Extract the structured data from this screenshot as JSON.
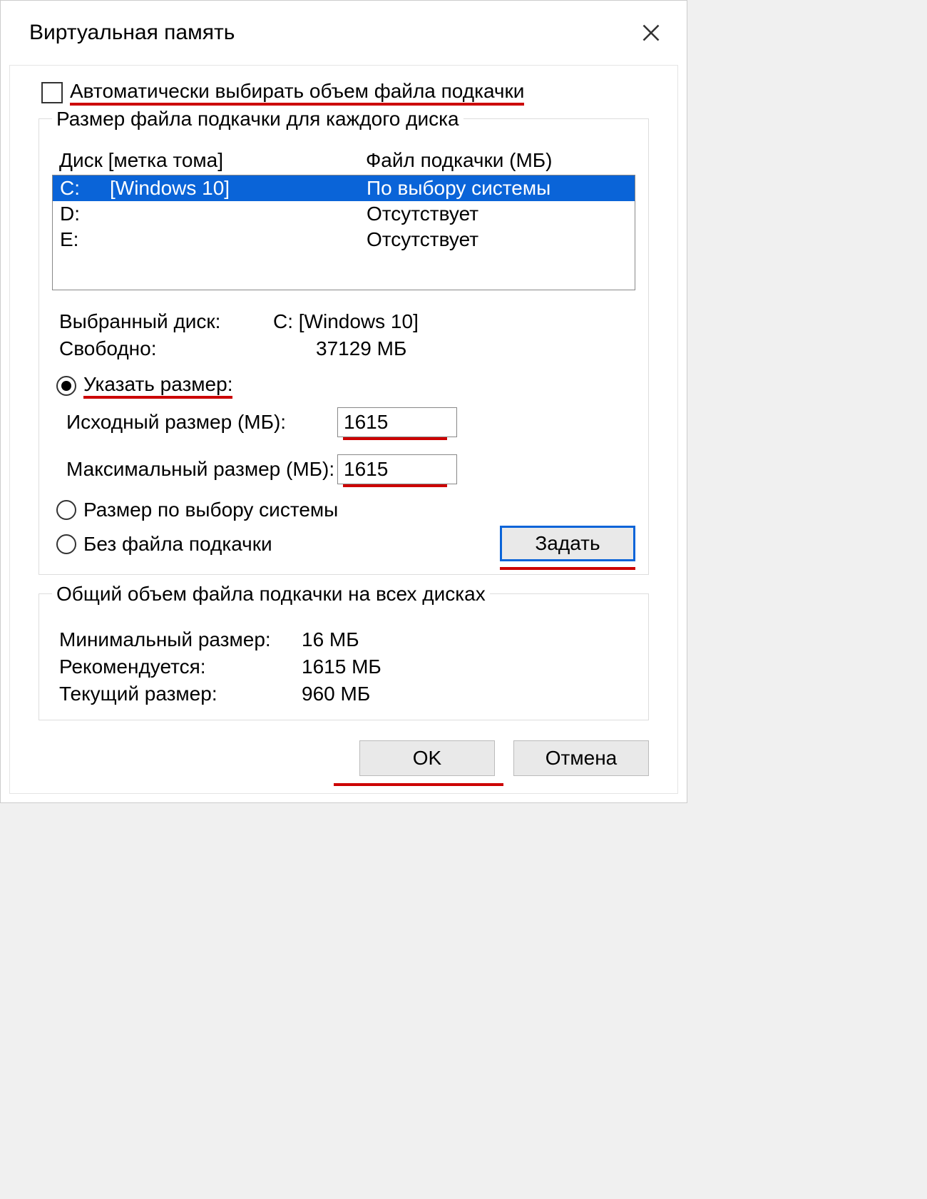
{
  "title": "Виртуальная память",
  "auto_checkbox_label": "Автоматически выбирать объем файла подкачки",
  "group1": {
    "legend": "Размер файла подкачки для каждого диска",
    "col_drive": "Диск [метка тома]",
    "col_pf": "Файл подкачки (МБ)",
    "rows": [
      {
        "drive": "C:",
        "label": "[Windows 10]",
        "pf": "По выбору системы"
      },
      {
        "drive": "D:",
        "label": "",
        "pf": "Отсутствует"
      },
      {
        "drive": "E:",
        "label": "",
        "pf": "Отсутствует"
      }
    ],
    "selected_index": 0
  },
  "selected_drive_label": "Выбранный диск:",
  "selected_drive_value": "C:  [Windows 10]",
  "free_label": "Свободно:",
  "free_value": "37129 МБ",
  "radio_custom": "Указать размер:",
  "initial_label": "Исходный размер (МБ):",
  "initial_value": "1615",
  "max_label": "Максимальный размер (МБ):",
  "max_value": "1615",
  "radio_system": "Размер по выбору системы",
  "radio_nofile": "Без файла подкачки",
  "set_button": "Задать",
  "group2": {
    "legend": "Общий объем файла подкачки на всех дисках",
    "min_label": "Минимальный размер:",
    "min_value": "16 МБ",
    "rec_label": "Рекомендуется:",
    "rec_value": "1615 МБ",
    "cur_label": "Текущий размер:",
    "cur_value": "960 МБ"
  },
  "ok_button": "OK",
  "cancel_button": "Отмена"
}
